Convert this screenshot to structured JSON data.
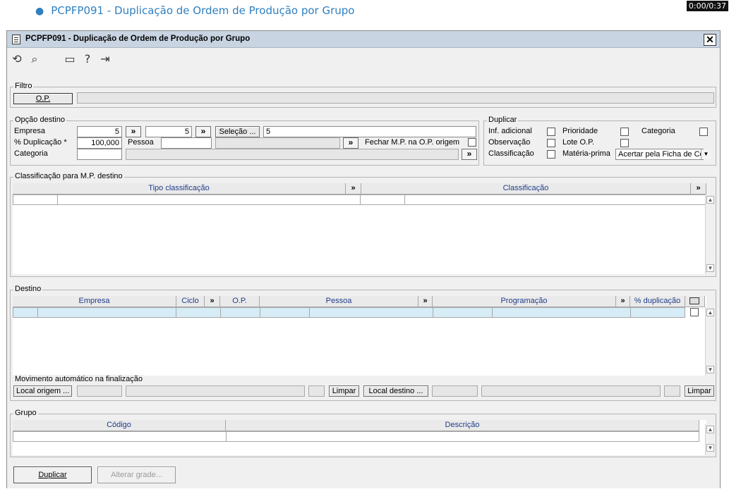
{
  "page": {
    "bullet_link": "PCPFP091 - Duplicação de Ordem de Produção por Grupo",
    "timer": "0:00/0:37"
  },
  "window": {
    "title": "PCPFP091 - Duplicação de Ordem de Produção por Grupo",
    "close_glyph": "✕",
    "icons": [
      "undo-icon",
      "search-icon",
      "calendar-icon",
      "help-icon",
      "exit-icon"
    ]
  },
  "filtro": {
    "legend": "Filtro",
    "op_button": "O.P.",
    "op_value": ""
  },
  "opcao_destino": {
    "legend": "Opção destino",
    "empresa_label": "Empresa",
    "empresa_value1": "5",
    "empresa_value2": "5",
    "selecao_button": "Seleção ...",
    "selecao_value": "5",
    "pct_label": "% Duplicação *",
    "pct_value": "100,000",
    "pessoa_label": "Pessoa",
    "pessoa_value": "",
    "fechar_label": "Fechar M.P. na O.P. origem",
    "categoria_label": "Categoria",
    "categoria_value": "",
    "dbl_glyph": "»"
  },
  "duplicar": {
    "legend": "Duplicar",
    "inf_adicional": "Inf. adicional",
    "prioridade": "Prioridade",
    "categoria": "Categoria",
    "observacao": "Observação",
    "lote_op": "Lote O.P.",
    "classificacao": "Classificação",
    "materia_prima": "Matéria-prima",
    "materia_select": "Acertar pela Ficha de Co"
  },
  "classificacao_mp": {
    "legend": "Classificação para M.P. destino",
    "col_tipo": "Tipo classificação",
    "col_classificacao": "Classificação"
  },
  "destino": {
    "legend": "Destino",
    "columns": [
      "Empresa",
      "Ciclo",
      "O.P.",
      "Pessoa",
      "Programação",
      "% duplicação"
    ]
  },
  "movimento": {
    "legend": "Movimento automático na finalização",
    "local_origem": "Local origem ...",
    "limpar1": "Limpar",
    "local_destino": "Local destino ...",
    "limpar2": "Limpar"
  },
  "grupo": {
    "legend": "Grupo",
    "col_codigo": "Código",
    "col_descricao": "Descrição"
  },
  "actions": {
    "duplicar": "Duplicar",
    "alterar_grade": "Alterar grade..."
  },
  "colors": {
    "titlebar": "#c9d4e2",
    "header_text": "#1f3c88",
    "selected_row": "#d6ecf7",
    "link": "#2f7fbf"
  }
}
